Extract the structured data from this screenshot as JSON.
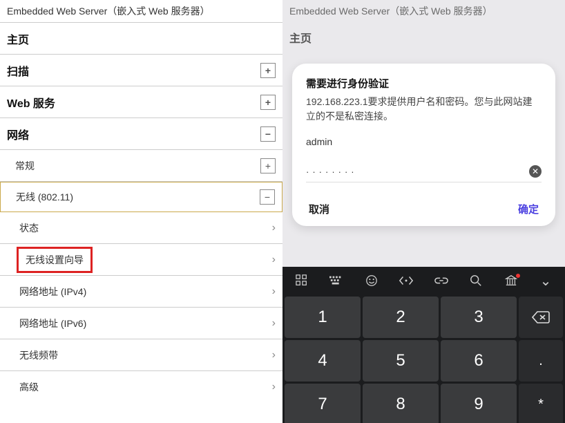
{
  "header": {
    "title": "Embedded Web Server（嵌入式 Web 服务器）"
  },
  "left": {
    "home": "主页",
    "scan": "扫描",
    "webservices": "Web 服务",
    "network": "网络",
    "general": "常规",
    "wireless": "无线 (802.11)",
    "status": "状态",
    "wizard": "无线设置向导",
    "ipv4": "网络地址 (IPv4)",
    "ipv6": "网络地址 (IPv6)",
    "band": "无线频带",
    "advanced": "高级"
  },
  "right": {
    "home": "主页",
    "dialog": {
      "title": "需要进行身份验证",
      "message": "192.168.223.1要求提供用户名和密码。您与此网站建立的不是私密连接。",
      "username": "admin",
      "password_mask": "········",
      "cancel": "取消",
      "ok": "确定"
    },
    "keys": {
      "k1": "1",
      "k2": "2",
      "k3": "3",
      "k4": "4",
      "k5": "5",
      "k6": "6",
      "k7": "7",
      "k8": "8",
      "k9": "9",
      "dot": ".",
      "star": "*",
      "hash": "#"
    }
  },
  "icons": {
    "plus": "+",
    "minus": "−",
    "chev": "›",
    "close": "✕",
    "down": "⌄"
  }
}
